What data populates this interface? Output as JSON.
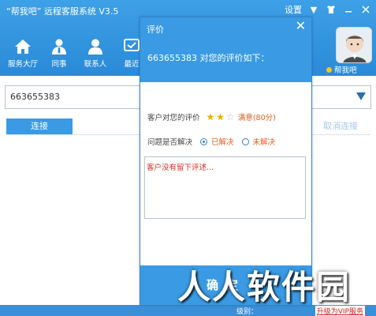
{
  "app": {
    "title": "“帮我吧” 远程客服系统 V3.5",
    "settings_label": "设置"
  },
  "nav": [
    {
      "label": "服务大厅",
      "icon": "home-icon"
    },
    {
      "label": "同事",
      "icon": "colleague-icon"
    },
    {
      "label": "联系人",
      "icon": "contacts-icon"
    },
    {
      "label": "最近",
      "icon": "recent-icon"
    }
  ],
  "profile": {
    "label": "帮我吧"
  },
  "connection": {
    "id_value": "663655383",
    "connect_label": "连接",
    "cancel_label": "取消连接"
  },
  "status_bar": {
    "level_label": "级别：",
    "vip_link": "升级为VIP服务"
  },
  "dialog": {
    "title": "评价",
    "subtitle": "663655383 对您的评价如下：",
    "rating_label": "客户对您的评价",
    "stars_filled": 2,
    "stars_total": 3,
    "rating_text": "满意(80分)",
    "resolved_label": "问题是否解决",
    "options": [
      {
        "label": "已解决",
        "checked": true
      },
      {
        "label": "未解决",
        "checked": false
      }
    ],
    "comment": "客户没有留下评述...",
    "ok_label": "确定"
  },
  "watermark": "人人软件园",
  "colors": {
    "primary": "#3a9be4",
    "accent_text": "#e06020",
    "comment_text": "#d83020"
  }
}
